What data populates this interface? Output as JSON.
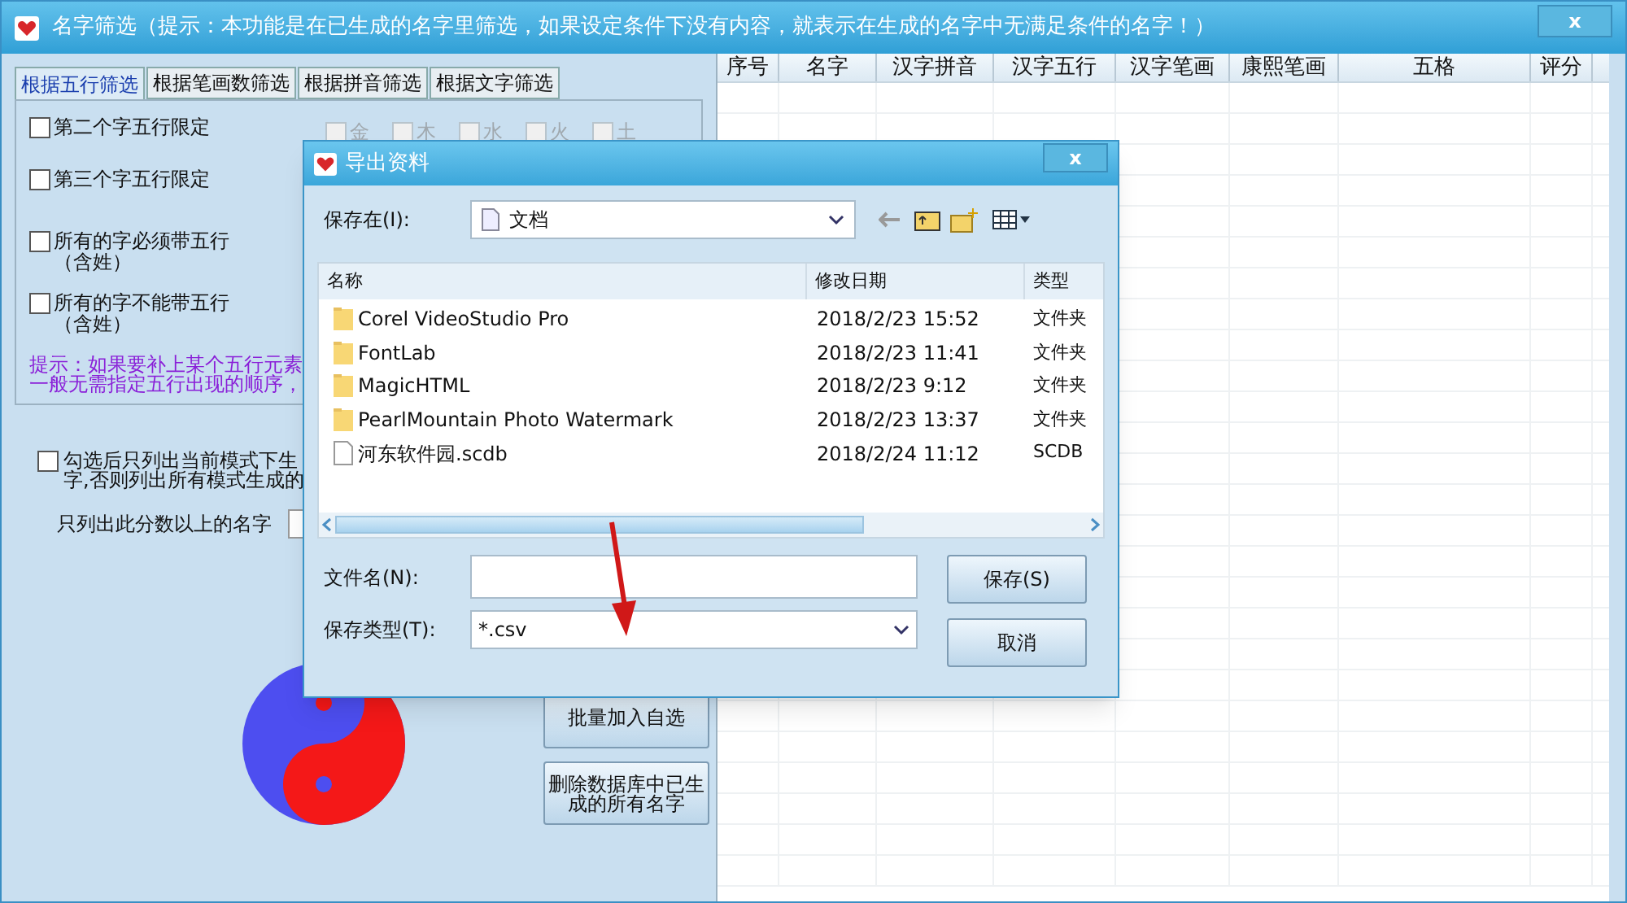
{
  "window": {
    "title": "名字筛选（提示：本功能是在已生成的名字里筛选，如果设定条件下没有内容，就表示在生成的名字中无满足条件的名字！）",
    "close": "x"
  },
  "tabs": [
    {
      "label": "根据五行筛选",
      "selected": true
    },
    {
      "label": "根据笔画数筛选",
      "selected": false
    },
    {
      "label": "根据拼音筛选",
      "selected": false
    },
    {
      "label": "根据文字筛选",
      "selected": false
    }
  ],
  "filters": [
    {
      "label": "第二个字五行限定",
      "checked": false,
      "elements": [
        {
          "label": "金",
          "checked": false,
          "disabled": true
        },
        {
          "label": "木",
          "checked": false,
          "disabled": true
        },
        {
          "label": "水",
          "checked": false,
          "disabled": true
        },
        {
          "label": "火",
          "checked": false,
          "disabled": true
        },
        {
          "label": "土",
          "checked": false,
          "disabled": true
        }
      ]
    },
    {
      "label": "第三个字五行限定",
      "checked": false
    },
    {
      "label": "所有的字必须带五行（含姓）",
      "checked": false
    },
    {
      "label": "所有的字不能带五行（含姓）",
      "checked": false
    }
  ],
  "tip": [
    "提示：如果要补上某个五行元素",
    "一般无需指定五行出现的顺序，"
  ],
  "mode_option": {
    "lines": [
      "勾选后只列出当前模式下生",
      "字,否则列出所有模式生成的"
    ],
    "checked": false
  },
  "score_label": "只列出此分数以上的名字",
  "buttons": [
    "批量加入自选",
    "删除数据库中已生成的所有名字"
  ],
  "table": {
    "columns": [
      "序号",
      "名字",
      "汉字拼音",
      "汉字五行",
      "汉字笔画",
      "康熙笔画",
      "五格",
      "评分"
    ]
  },
  "dialog": {
    "title": "导出资料",
    "close": "x",
    "save_in_label": "保存在(I):",
    "save_in_value": "文档",
    "columns": [
      "名称",
      "修改日期",
      "类型"
    ],
    "files": [
      {
        "kind": "folder",
        "name": "Corel VideoStudio Pro",
        "date": "2018/2/23 15:52",
        "type": "文件夹"
      },
      {
        "kind": "folder",
        "name": "FontLab",
        "date": "2018/2/23 11:41",
        "type": "文件夹"
      },
      {
        "kind": "folder",
        "name": "MagicHTML",
        "date": "2018/2/23 9:12",
        "type": "文件夹"
      },
      {
        "kind": "folder",
        "name": "PearlMountain Photo Watermark",
        "date": "2018/2/23 13:37",
        "type": "文件夹"
      },
      {
        "kind": "file",
        "name": "河东软件园.scdb",
        "date": "2018/2/24 11:12",
        "type": "SCDB"
      }
    ],
    "filename_label": "文件名(N):",
    "filetype_label": "保存类型(T):",
    "filetype_value": "*.csv",
    "save_button": "保存(S)",
    "cancel_button": "取消"
  }
}
